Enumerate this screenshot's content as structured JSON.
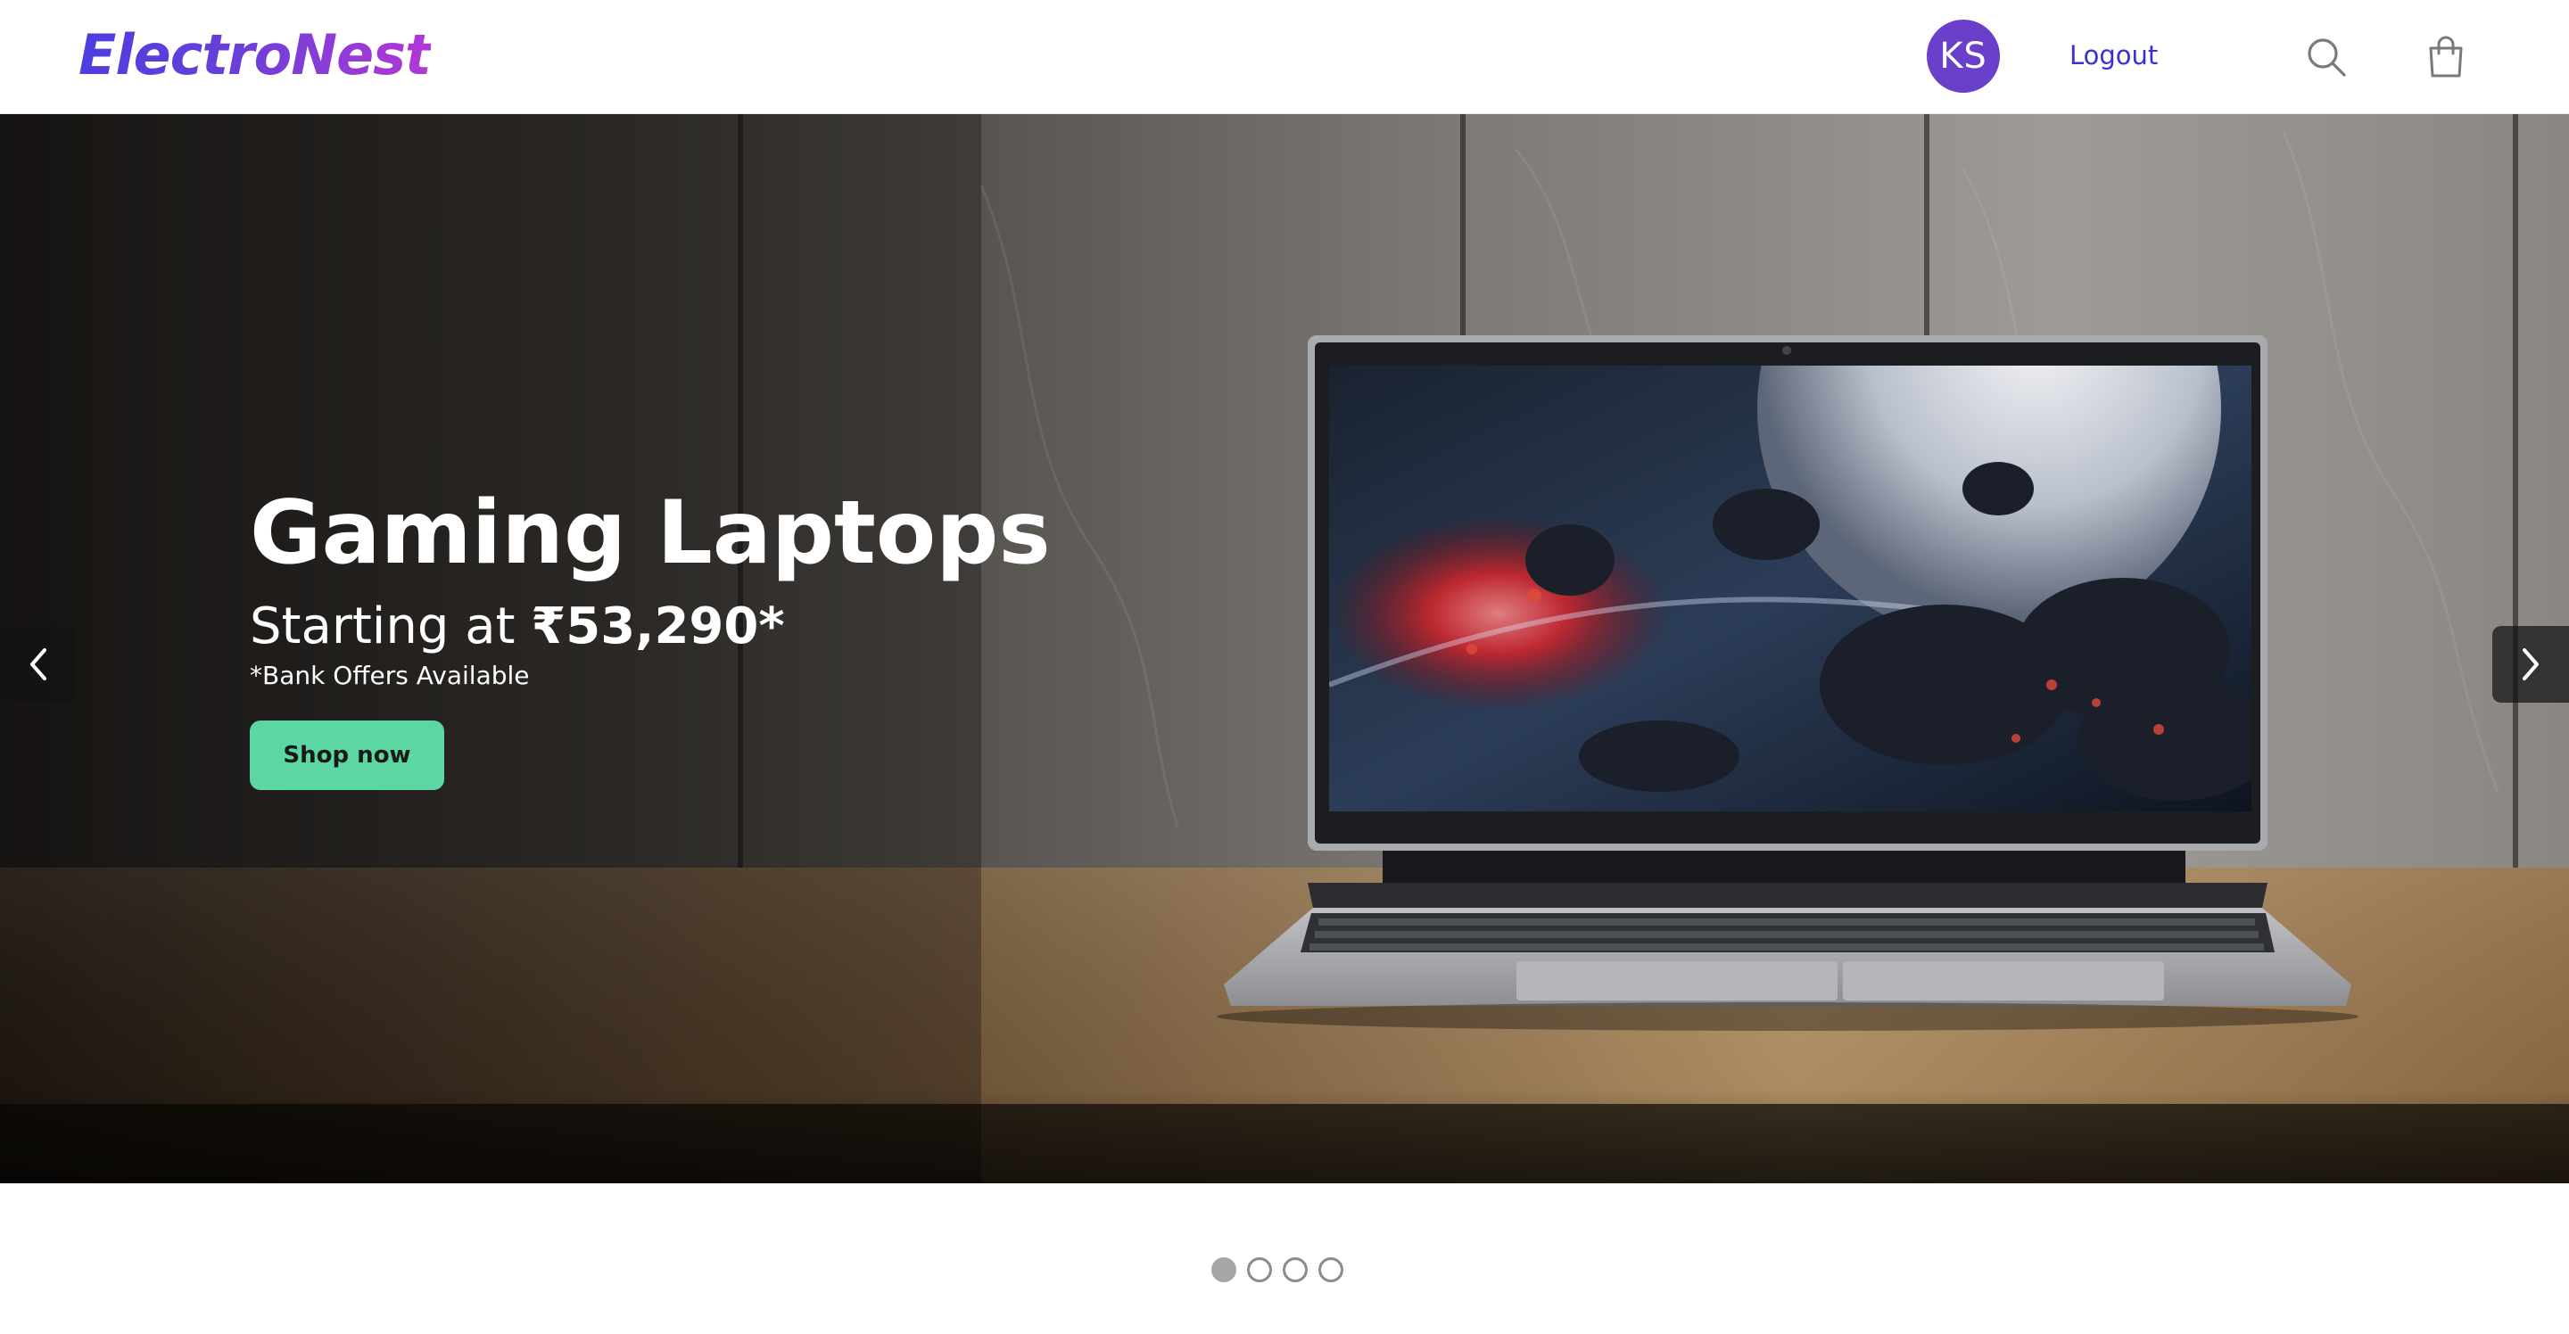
{
  "header": {
    "logo_text": "ElectroNest",
    "avatar_initials": "KS",
    "logout_label": "Logout",
    "icons": [
      "search-icon",
      "shopping-bag-icon"
    ]
  },
  "hero": {
    "title": "Gaming Laptops",
    "subtitle_prefix": "Starting at ",
    "price": "₹53,290*",
    "note": "*Bank Offers Available",
    "cta_label": "Shop now",
    "prev_icon": "chevron-left-icon",
    "next_icon": "chevron-right-icon"
  },
  "carousel": {
    "slides_count": 4,
    "active_index": 0
  },
  "colors": {
    "brand_start": "#4c3ee0",
    "brand_end": "#b338d6",
    "avatar_bg": "#6a3fc9",
    "link": "#3b2fd6",
    "cta_bg": "#5cd6a2"
  }
}
